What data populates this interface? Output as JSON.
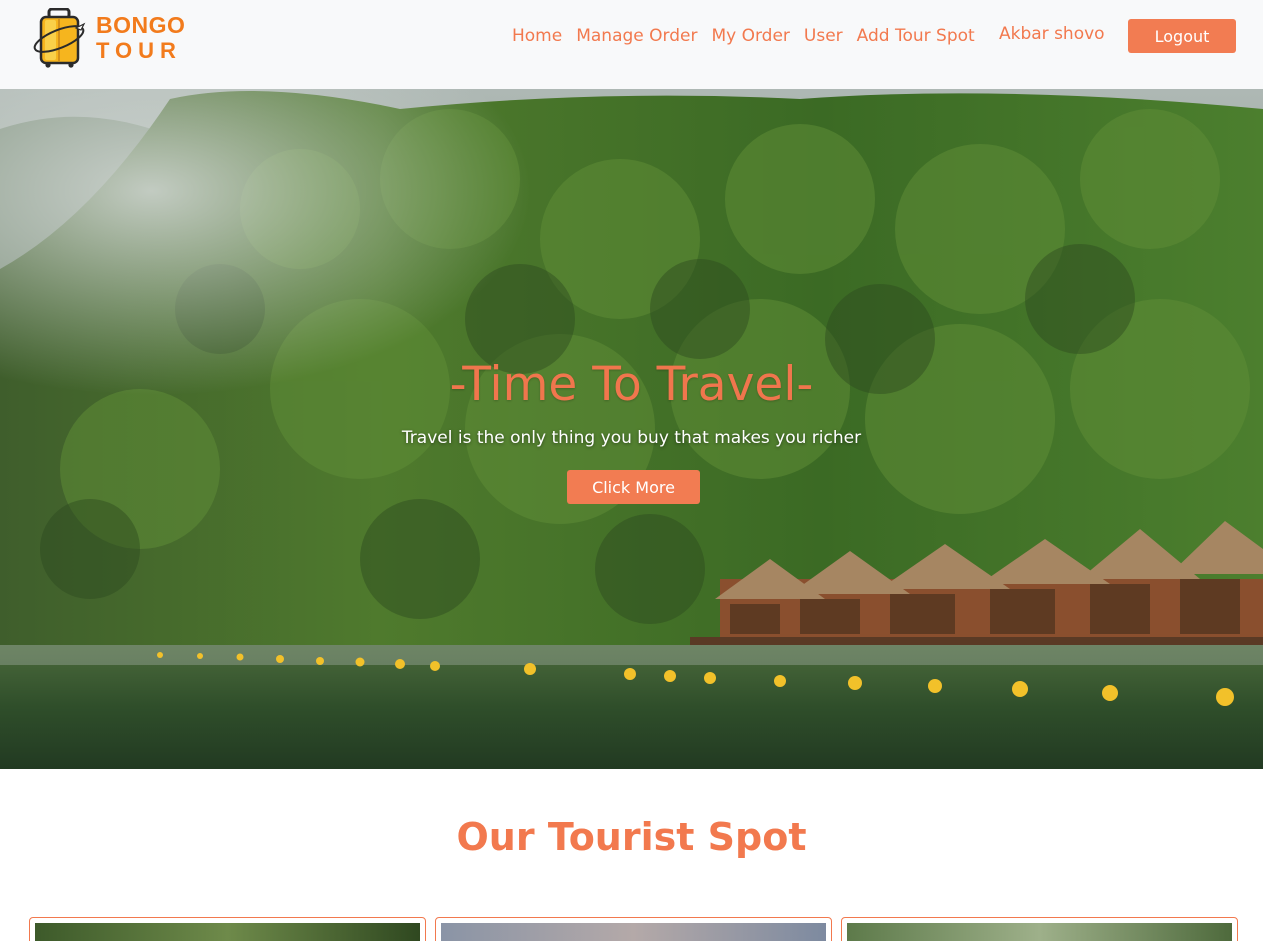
{
  "brand": {
    "line1": "BONGO",
    "line2": "TOUR",
    "icon": "suitcase-plane-icon",
    "color": "#f27b1c"
  },
  "nav": {
    "links": [
      "Home",
      "Manage Order",
      "My Order",
      "User",
      "Add Tour Spot"
    ],
    "user_name": "Akbar shovo",
    "logout_label": "Logout"
  },
  "hero": {
    "title": "-Time To Travel-",
    "subtitle": "Travel is the only thing you buy that makes you richer",
    "button_label": "Click More"
  },
  "section": {
    "title": "Our Tourist Spot"
  },
  "colors": {
    "accent": "#f27c52",
    "navbar_bg": "#f8f9fa"
  }
}
